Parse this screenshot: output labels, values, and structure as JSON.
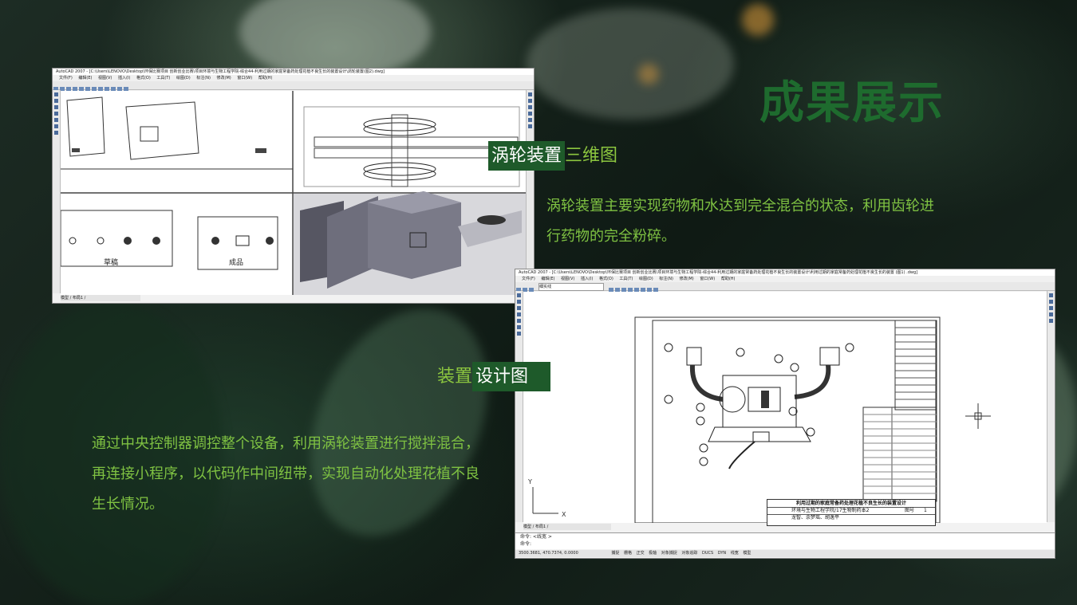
{
  "slide": {
    "title": "成果展示",
    "label_turbine_highlight": "涡轮装置",
    "label_turbine_rest": "三维图",
    "desc_turbine": "涡轮装置主要实现药物和水达到完全混合的状态，利用齿轮进行药物的完全粉碎。",
    "label_design_rest": "装置",
    "label_design_highlight": "设计图",
    "desc_design": "通过中央控制器调控整个设备，利用涡轮装置进行搅拌混合，再连接小程序，以代码作中间纽带，实现自动化处理花植不良生长情况。"
  },
  "cad_top": {
    "titlebar": "AutoCAD 2007 - [C:\\Users\\LENOVO\\Desktop\\环保比赛项目 创新创业比赛\\项目环境与生物工程学院-综合44-利用过期的家庭常备药处理花植不良生长的装置设计\\涡轮装置(图2).dwg]",
    "menu": [
      "文件(F)",
      "编辑(E)",
      "视图(V)",
      "插入(I)",
      "格式(O)",
      "工具(T)",
      "绘图(D)",
      "标注(N)",
      "修改(M)",
      "窗口(W)",
      "帮助(H)"
    ],
    "view_label_draft": "草稿",
    "view_label_final": "成品",
    "tabs": "模型 / 布局1 /"
  },
  "cad_bottom": {
    "titlebar": "AutoCAD 2007 - [C:\\Users\\LENOVO\\Desktop\\环保比赛项目 创新创业比赛\\项目环境与生物工程学院-综合44-利用过期的家庭常备药处理花植不良生长的装置设计\\利用过期的家庭常备药处理花植不良生长的装置 (图1) .dwg]",
    "menu": [
      "文件(F)",
      "编辑(E)",
      "视图(V)",
      "插入(I)",
      "格式(O)",
      "工具(T)",
      "绘图(D)",
      "标注(N)",
      "修改(M)",
      "窗口(W)",
      "帮助(H)"
    ],
    "layer": "细实线",
    "drawing_title": "利用过期的家庭常备药处理花植不良生长的装置设计",
    "drawing_no_label": "图号",
    "drawing_no": "1",
    "school": "环境与生物工程学院/17生物制药本2",
    "names": "龙智、余梦瑶、胡逸平",
    "tabs": "模型 / 布局1 /",
    "cmd1": "命令: <线宽 >",
    "cmd2": "命令:",
    "coords": "3500.3681, 470.7374, 0.0000",
    "status_items": [
      "捕捉",
      "栅格",
      "正交",
      "极轴",
      "对象捕捉",
      "对象追踪",
      "DUCS",
      "DYN",
      "线宽",
      "模型"
    ]
  },
  "colors": {
    "title": "#1e6b2e",
    "label": "#8cc63f",
    "highlight_bg": "#1e5a2a",
    "paragraph": "#7fc242"
  }
}
